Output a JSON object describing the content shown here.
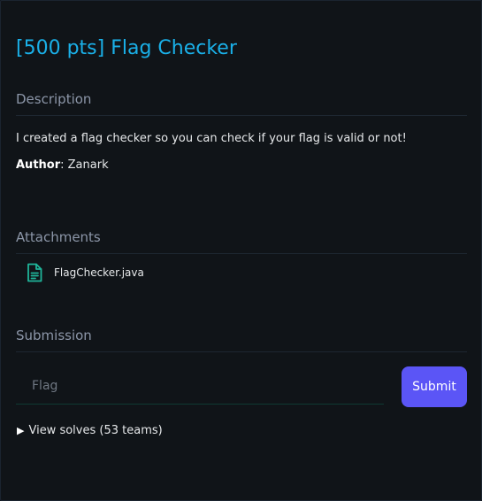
{
  "challenge": {
    "title": "[500 pts] Flag Checker"
  },
  "description": {
    "heading": "Description",
    "text": "I created a flag checker so you can check if your flag is valid or not!",
    "author_label": "Author",
    "author_separator": ": ",
    "author_name": "Zanark"
  },
  "attachments": {
    "heading": "Attachments",
    "files": [
      {
        "name": "FlagChecker.java",
        "icon": "file-document-icon"
      }
    ]
  },
  "submission": {
    "heading": "Submission",
    "input_placeholder": "Flag",
    "input_value": "",
    "submit_label": "Submit",
    "solves_label": "View solves (53 teams)"
  },
  "colors": {
    "title": "#1ab0e8",
    "section_heading": "#8c96a8",
    "submit_button": "#5b55f6",
    "file_icon": "#1fb59a",
    "background": "#101418"
  }
}
